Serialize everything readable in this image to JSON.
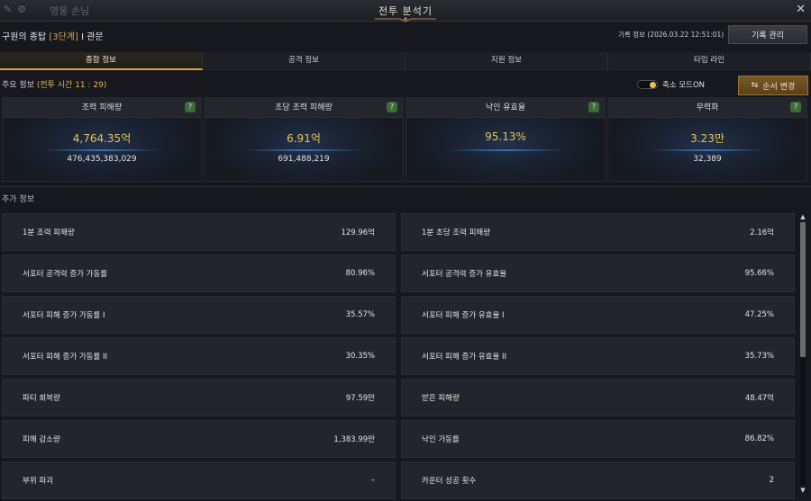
{
  "window": {
    "title": "전투 분석기",
    "bg_text": "영웅 손님"
  },
  "header": {
    "dungeon_prefix": "구원의 종탑 ",
    "dungeon_stage": "[3단계]",
    "dungeon_suffix": " I 관문",
    "record_info": "기록 정보 (2026.03.22 12:51:01)",
    "record_button": "기록 관리"
  },
  "tabs": [
    {
      "label": "종합 정보",
      "active": true
    },
    {
      "label": "공격 정보",
      "active": false
    },
    {
      "label": "지원 정보",
      "active": false
    },
    {
      "label": "타임 라인",
      "active": false
    }
  ],
  "main_info": {
    "label": "주요 정보 ",
    "battle_time": "(전투 시간 11 : 29)",
    "compact_mode": "축소 모드ON",
    "order_button": "순서 변경"
  },
  "cards": [
    {
      "title": "조력 피해량",
      "value": "4,764.35억",
      "sub": "476,435,383,029"
    },
    {
      "title": "초당 조력 피해량",
      "value": "6.91억",
      "sub": "691,488,219"
    },
    {
      "title": "낙인 유효율",
      "value": "95.13%",
      "sub": ""
    },
    {
      "title": "무력화",
      "value": "3.23만",
      "sub": "32,389"
    }
  ],
  "extra": {
    "label": "추가 정보",
    "left": [
      {
        "k": "1분 조력 피해량",
        "v": "129.96억"
      },
      {
        "k": "서포터 공격력 증가 가동률",
        "v": "80.96%"
      },
      {
        "k": "서포터 피해 증가 가동률 I",
        "v": "35.57%"
      },
      {
        "k": "서포터 피해 증가 가동률 II",
        "v": "30.35%"
      },
      {
        "k": "파티 회복량",
        "v": "97.59만"
      },
      {
        "k": "피해 감소량",
        "v": "1,383.99만"
      },
      {
        "k": "부위 파괴",
        "v": "–"
      }
    ],
    "right": [
      {
        "k": "1분 초당 조력 피해량",
        "v": "2.16억"
      },
      {
        "k": "서포터 공격력 증가 유효율",
        "v": "95.66%"
      },
      {
        "k": "서포터 피해 증가 유효율 I",
        "v": "47.25%"
      },
      {
        "k": "서포터 피해 증가 유효율 II",
        "v": "35.73%"
      },
      {
        "k": "받은 피해량",
        "v": "48.47억"
      },
      {
        "k": "낙인 가동률",
        "v": "86.82%"
      },
      {
        "k": "카운터 성공 횟수",
        "v": "2"
      }
    ]
  },
  "colors": {
    "accent_gold": "#d6a14a",
    "value_yellow": "#e9c451",
    "help_green": "#3d6b3a"
  }
}
